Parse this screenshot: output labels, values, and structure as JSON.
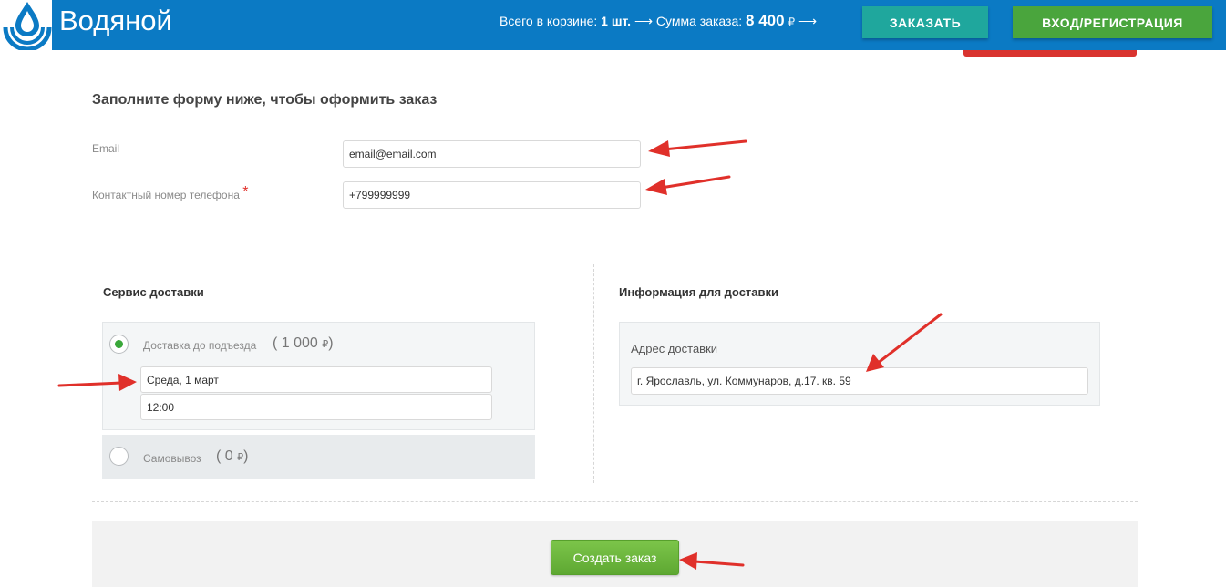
{
  "header": {
    "brand": "Водяной",
    "cart_prefix": "Всего в корзине:",
    "cart_count": "1 шт.",
    "arrow1": "⟶",
    "sum_label": "Сумма заказа:",
    "sum_value": "8 400",
    "currency": "₽",
    "arrow2": "⟶",
    "order_button": "ЗАКАЗАТЬ",
    "login_button": "ВХОД/РЕГИСТРАЦИЯ",
    "colors": {
      "bar": "#0b7ac4",
      "order": "#1fa79d",
      "login": "#4aa53d"
    }
  },
  "form": {
    "title": "Заполните форму ниже, чтобы оформить заказ",
    "email_label": "Email",
    "email_value": "email@email.com",
    "phone_label": "Контактный номер телефона",
    "phone_required": "*",
    "phone_value": "+799999999"
  },
  "delivery": {
    "title": "Сервис доставки",
    "options": [
      {
        "label": "Доставка до подъезда",
        "price_open": "(",
        "price": "1 000",
        "currency": "₽",
        "price_close": ")",
        "selected": true
      },
      {
        "label": "Самовывоз",
        "price_open": "(",
        "price": "0",
        "currency": "₽",
        "price_close": ")",
        "selected": false
      }
    ],
    "date_value": "Среда, 1 март",
    "time_value": "12:00"
  },
  "delivery_info": {
    "title": "Информация для доставки",
    "address_label": "Адрес доставки",
    "address_value": "г. Ярославль, ул. Коммунаров, д.17. кв. 59"
  },
  "submit": {
    "label": "Создать заказ"
  },
  "annotation_color": "#e0302a"
}
